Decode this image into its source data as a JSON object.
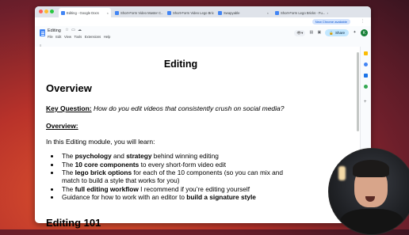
{
  "browser": {
    "tabs": [
      {
        "label": "Editing - Google Docs",
        "active": true,
        "color": "#4285f4"
      },
      {
        "label": "Short-Form Video Master C...",
        "active": false,
        "color": "#4285f4"
      },
      {
        "label": "Short-Form Video Lego Brick...",
        "active": false,
        "color": "#4285f4"
      },
      {
        "label": "Swapyable",
        "active": false,
        "color": "#4285f4"
      },
      {
        "label": "Short-Form Lego Bricks - Fu...",
        "active": false,
        "color": "#4285f4"
      }
    ],
    "new_chrome_label": "New Chrome available",
    "profile_initial": "EE"
  },
  "docs": {
    "title": "Editing",
    "menu": [
      "File",
      "Edit",
      "View",
      "Tools",
      "Extensions",
      "Help"
    ],
    "share_label": "Share",
    "avatar_initial": "K",
    "accent": "#c2e7ff"
  },
  "document": {
    "heading": "Editing",
    "section": "Overview",
    "key_question_label": "Key Question:",
    "key_question_text": "How do you edit videos that consistently crush on social media?",
    "overview_label": "Overview:",
    "intro": "In this Editing module, you will learn:",
    "bullets": [
      [
        {
          "t": "The "
        },
        {
          "t": "psychology",
          "b": true
        },
        {
          "t": " and "
        },
        {
          "t": "strategy",
          "b": true
        },
        {
          "t": " behind winning editing"
        }
      ],
      [
        {
          "t": "The "
        },
        {
          "t": "10 core components",
          "b": true
        },
        {
          "t": " to every short-form video edit"
        }
      ],
      [
        {
          "t": "The "
        },
        {
          "t": "lego brick options",
          "b": true
        },
        {
          "t": " for each of the 10 components (so you can mix and match to build a style that works for you)"
        }
      ],
      [
        {
          "t": "The "
        },
        {
          "t": "full editing workflow",
          "b": true
        },
        {
          "t": " I recommend if you’re editing yourself"
        }
      ],
      [
        {
          "t": "Guidance for how to work with an editor to "
        },
        {
          "t": "build a signature style",
          "b": true
        }
      ]
    ],
    "next_heading": "Editing 101"
  }
}
